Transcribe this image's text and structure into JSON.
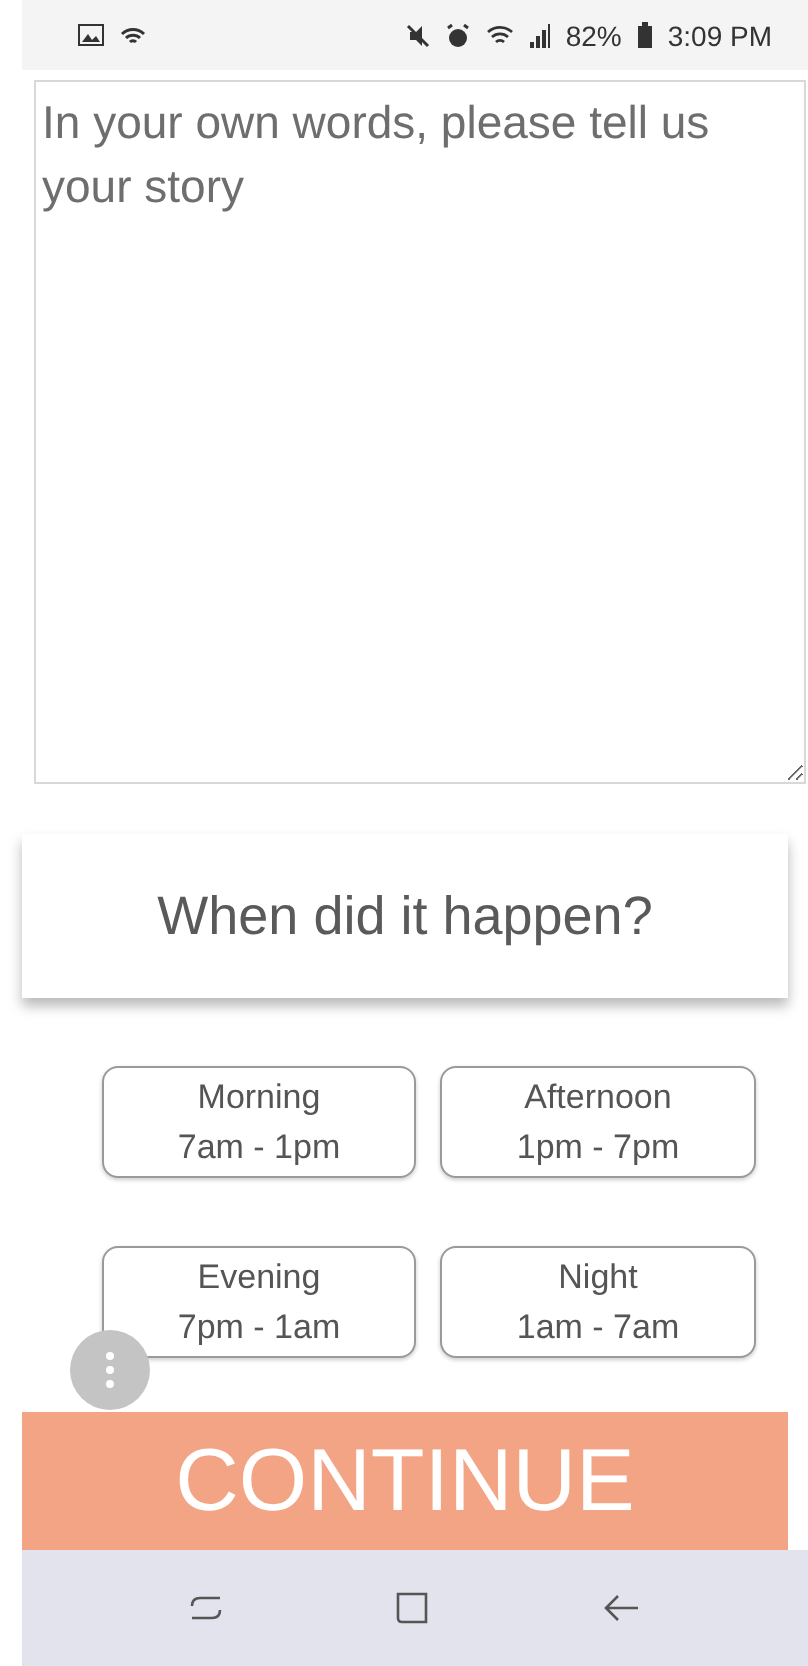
{
  "status_bar": {
    "battery": "82%",
    "time": "3:09 PM"
  },
  "story": {
    "placeholder": "In your own words, please tell us your story"
  },
  "question": "When did it happen?",
  "options": [
    {
      "label": "Morning",
      "range": "7am - 1pm",
      "selected": false
    },
    {
      "label": "Afternoon",
      "range": "1pm - 7pm",
      "selected": false
    },
    {
      "label": "Evening",
      "range": "7pm - 1am",
      "selected": false
    },
    {
      "label": "Night",
      "range": "1am - 7am",
      "selected": false
    }
  ],
  "continue_button": "CONTINUE"
}
